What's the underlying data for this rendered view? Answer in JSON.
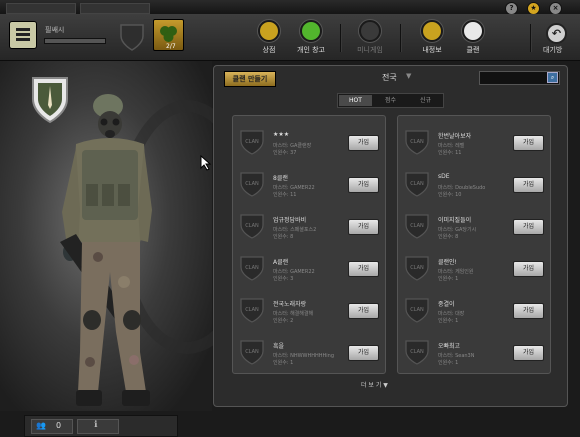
{
  "window_buttons": {
    "help": "?",
    "star": "★",
    "close": "×"
  },
  "header": {
    "username": "필쌔시",
    "clan_count": "2/7",
    "nav": [
      {
        "label": "상점",
        "color": "#c9a21f"
      },
      {
        "label": "개인 창고",
        "color": "#52b52d"
      },
      {
        "label": "미니게임",
        "color": "#3a3a3a"
      },
      {
        "label": "내정보",
        "color": "#c9a21f"
      },
      {
        "label": "클랜",
        "color": "#e8e8e8"
      }
    ],
    "back_label": "대기방",
    "back_icon": "undo-arrow-icon"
  },
  "panel": {
    "make_clan": "클랜 만들기",
    "region": "전국",
    "region_arrow": "▼",
    "search_icon": "search-icon",
    "tabs": [
      "HOT",
      "점수",
      "신규"
    ],
    "shield_text": "CLAN",
    "join_label": "가입",
    "more": "더 보 기 ▼"
  },
  "clans_left": [
    {
      "name": "★★★",
      "master": "마스터: GA클랜장",
      "members": "인원수: 37"
    },
    {
      "name": "8클랜",
      "master": "마스터: GAMER22",
      "members": "인원수: 11"
    },
    {
      "name": "업규정담바비",
      "master": "마스터: 스페셜포스2",
      "members": "인원수: 8"
    },
    {
      "name": "A클랜",
      "master": "마스터: GAMER22",
      "members": "인원수: 3"
    },
    {
      "name": "전국노래자랑",
      "master": "마스터: 해결해결해",
      "members": "인원수: 2"
    },
    {
      "name": "흑을",
      "master": "마스터: NHWWHHHHHing",
      "members": "인원수: 1"
    }
  ],
  "clans_right": [
    {
      "name": "한번날아보자",
      "master": "마스터: 레벨",
      "members": "인원수: 11"
    },
    {
      "name": "sDE",
      "master": "마스터: DoubleSudo",
      "members": "인원수: 10"
    },
    {
      "name": "이미지질들이",
      "master": "마스터: GA당기시",
      "members": "인원수: 8"
    },
    {
      "name": "클랜인!",
      "master": "마스터: 게임인원",
      "members": "인원수: 1"
    },
    {
      "name": "중결이",
      "master": "마스터: 대장",
      "members": "인원수: 1"
    },
    {
      "name": "오빠최고",
      "master": "마스터: Sean3N",
      "members": "인원수: 1"
    }
  ],
  "status": {
    "count": "0"
  }
}
